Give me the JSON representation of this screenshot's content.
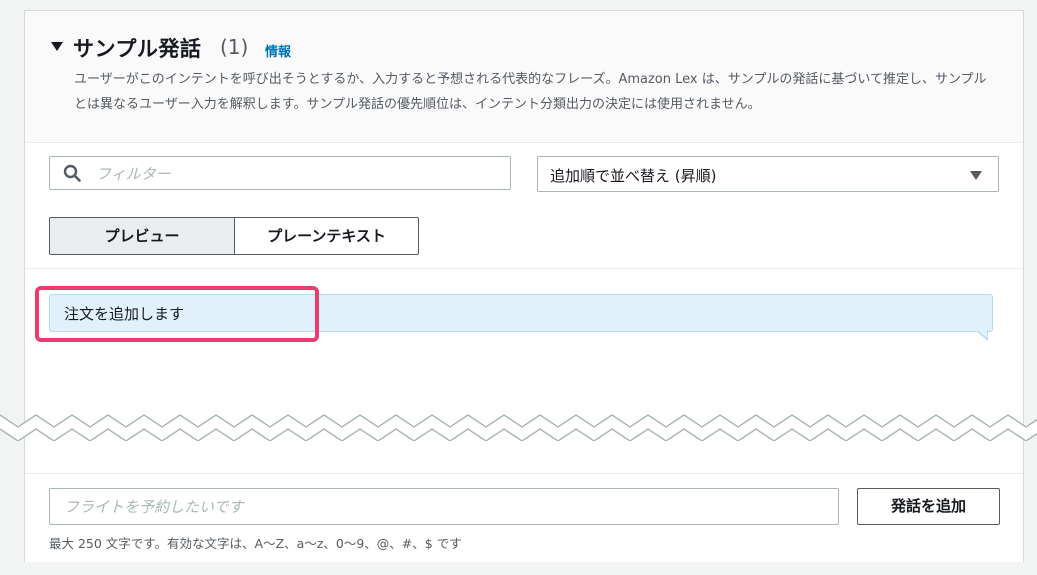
{
  "section": {
    "title": "サンプル発話",
    "count": "(1)",
    "info_link": "情報",
    "description": "ユーザーがこのインテントを呼び出そうとするか、入力すると予想される代表的なフレーズ。Amazon Lex は、サンプルの発話に基づいて推定し、サンプルとは異なるユーザー入力を解釈します。サンプル発話の優先順位は、インテント分類出力の決定には使用されません。"
  },
  "filter": {
    "placeholder": "フィルター",
    "icon": "search-icon"
  },
  "sort": {
    "selected": "追加順で並べ替え (昇順)"
  },
  "view_toggle": {
    "preview_label": "プレビュー",
    "plaintext_label": "プレーンテキスト",
    "active": "preview"
  },
  "utterances": [
    {
      "text": "注文を追加します"
    }
  ],
  "add": {
    "placeholder": "フライトを予約したいです",
    "button_label": "発話を追加",
    "hint": "最大 250 文字です。有効な文字は、A～Z、a～z、0～9、@、#、$ です"
  },
  "colors": {
    "highlight": "#ec3b6d",
    "bubble": "#e1f1fb",
    "link": "#0073bb"
  }
}
